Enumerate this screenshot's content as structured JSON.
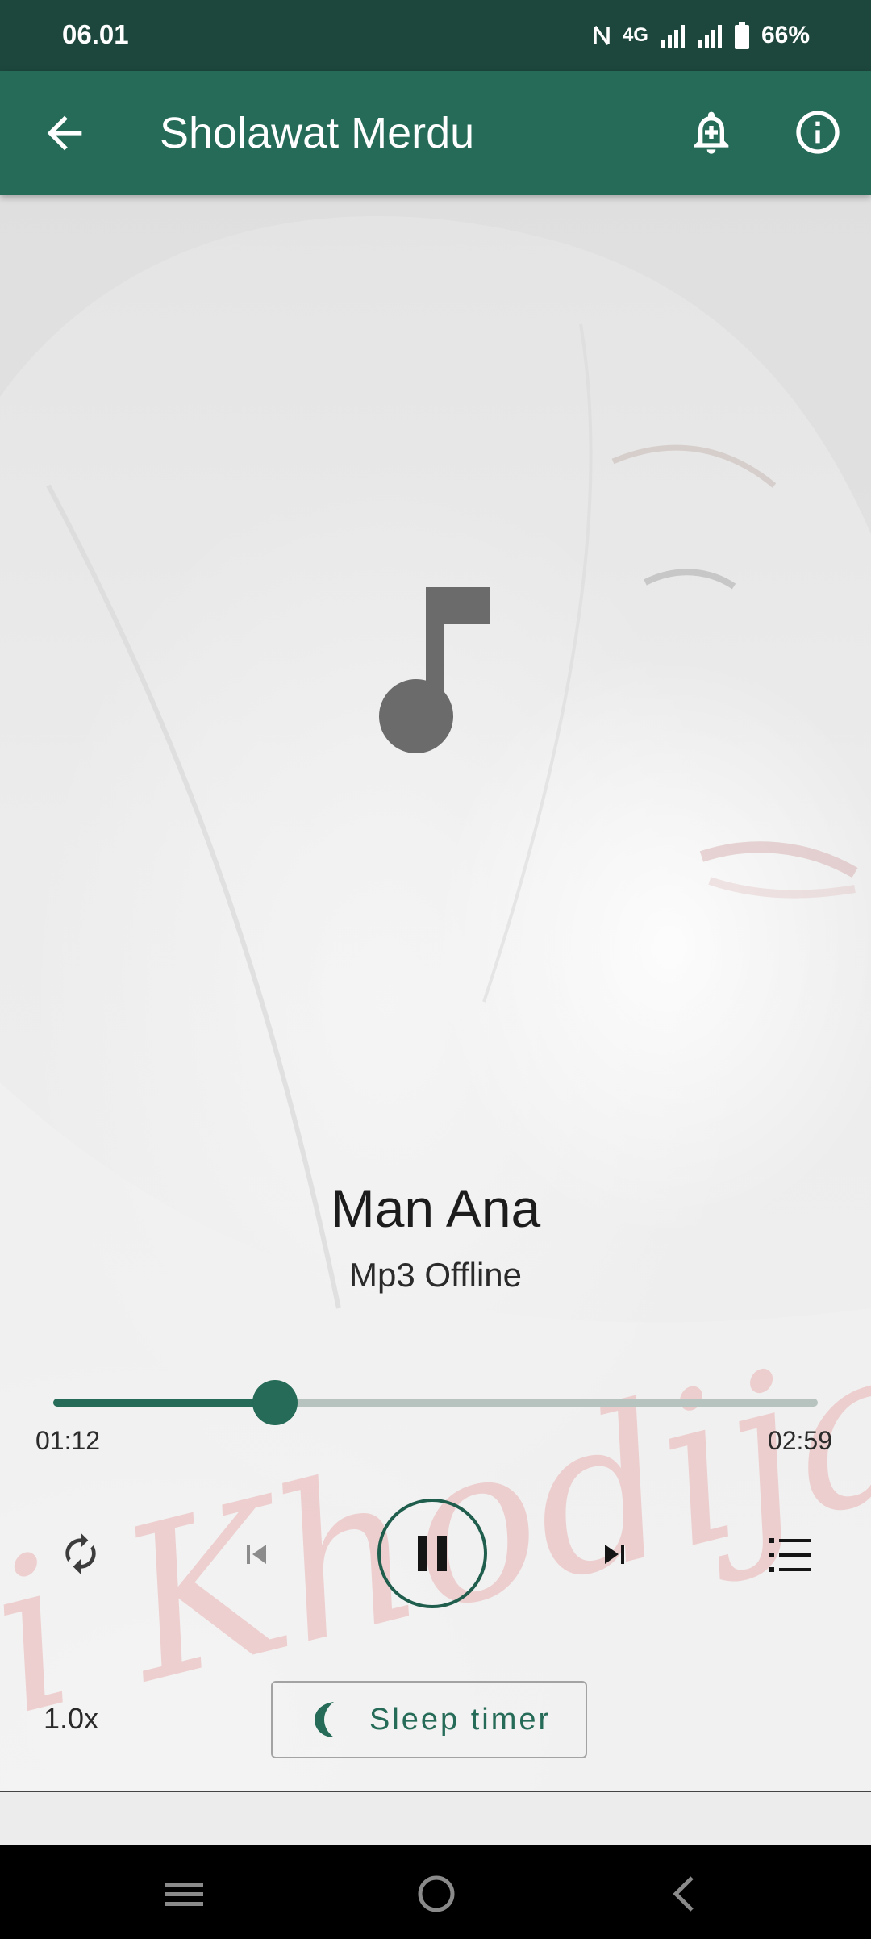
{
  "status_bar": {
    "time": "06.01",
    "network": "4G",
    "battery": "66%",
    "icons": [
      "nfc-icon",
      "signal-icon",
      "signal-icon",
      "battery-icon"
    ]
  },
  "app_bar": {
    "title": "Sholawat Merdu",
    "icons": [
      "back-arrow-icon",
      "alarm-add-icon",
      "info-icon"
    ]
  },
  "player": {
    "artwork_icon": "music-note-icon",
    "track_title": "Man Ana",
    "track_subtitle": "Mp3 Offline",
    "current_time": "01:12",
    "total_time": "02:59",
    "progress_fraction": 0.29,
    "state": "playing",
    "controls": [
      "repeat-icon",
      "previous-icon",
      "pause-icon",
      "next-icon",
      "playlist-icon"
    ]
  },
  "options": {
    "speed_label": "1.0x",
    "sleep_timer_label": "Sleep timer",
    "sleep_icon": "moon-icon"
  },
  "background_watermark_text": "i Khodijah",
  "colors": {
    "status_bar": "#1d473c",
    "app_bar": "#256b57",
    "accent": "#256b57",
    "artwork_icon": "#6b6b6b"
  },
  "system_nav": [
    "recents-icon",
    "home-icon",
    "back-icon"
  ]
}
